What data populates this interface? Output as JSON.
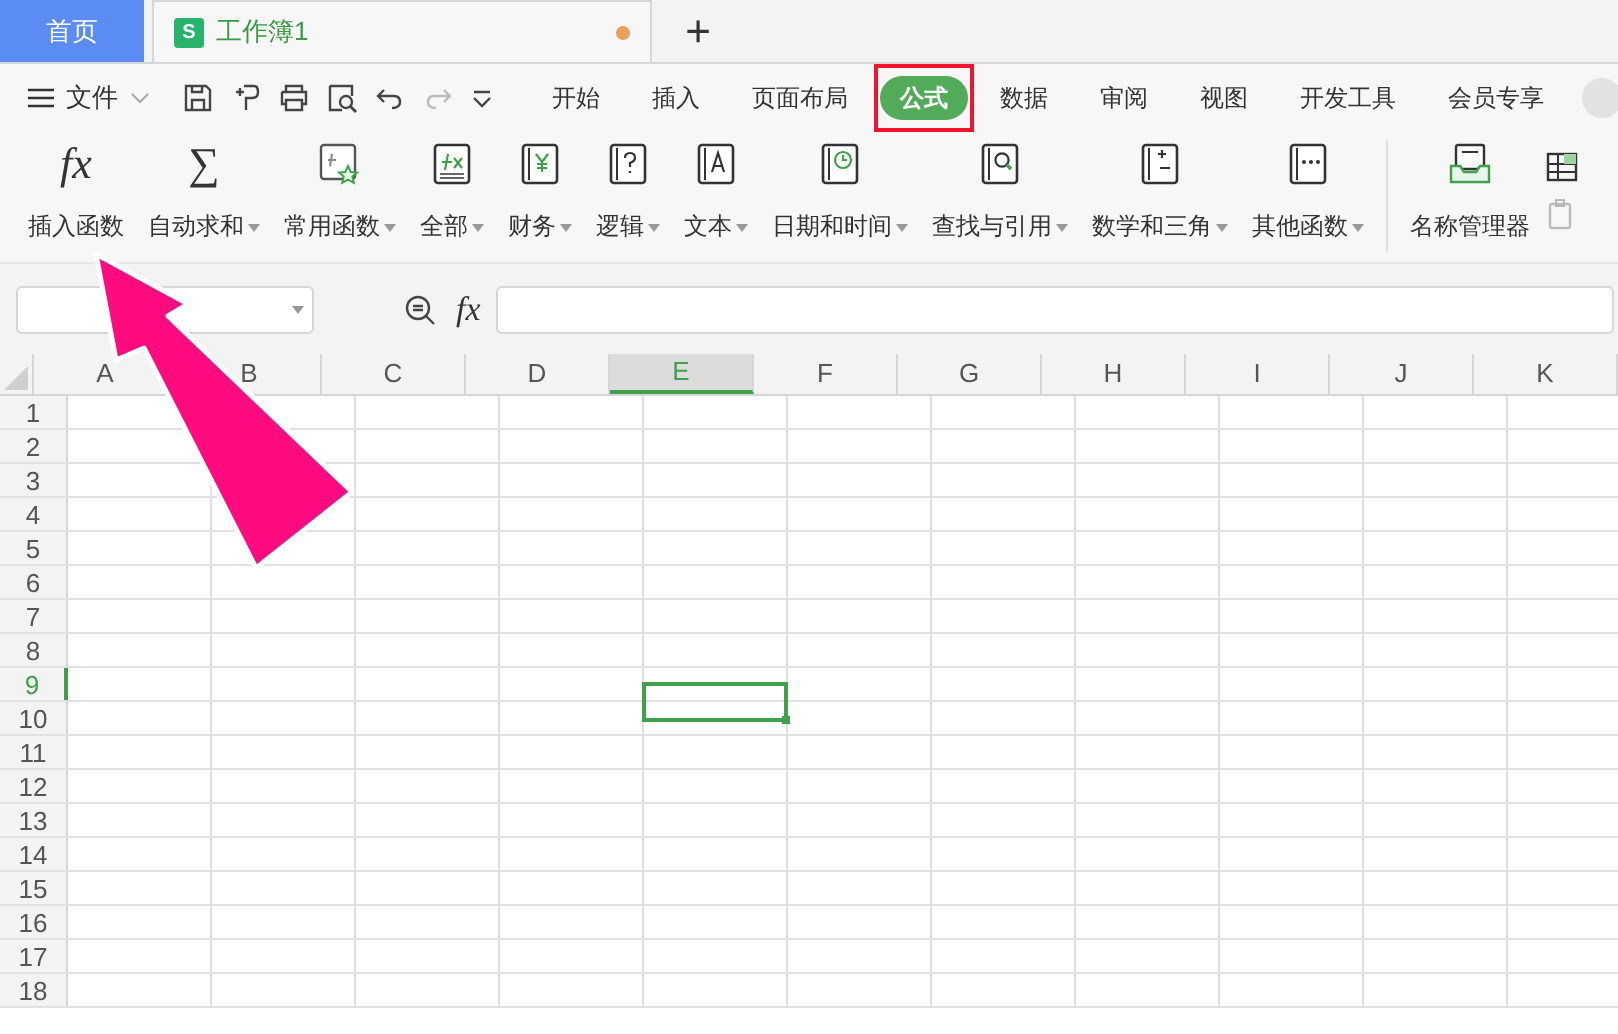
{
  "window_tabs": [
    {
      "kind": "home",
      "label": "首页",
      "selected": false
    },
    {
      "kind": "document",
      "label": "工作簿1",
      "icon_letter": "S",
      "unsaved": true,
      "selected": true
    }
  ],
  "new_tab": "+",
  "file_menu": "文件",
  "ribbon_tabs": [
    {
      "label": "开始",
      "selected": false,
      "highlighted": false
    },
    {
      "label": "插入",
      "selected": false,
      "highlighted": false
    },
    {
      "label": "页面布局",
      "selected": false,
      "highlighted": false
    },
    {
      "label": "公式",
      "selected": true,
      "highlighted": true
    },
    {
      "label": "数据",
      "selected": false,
      "highlighted": false
    },
    {
      "label": "审阅",
      "selected": false,
      "highlighted": false
    },
    {
      "label": "视图",
      "selected": false,
      "highlighted": false
    },
    {
      "label": "开发工具",
      "selected": false,
      "highlighted": false
    },
    {
      "label": "会员专享",
      "selected": false,
      "highlighted": false
    }
  ],
  "ribbon_buttons": [
    {
      "kind": "fx",
      "icon_text": "fx",
      "label": "插入函数",
      "dropdown": false
    },
    {
      "kind": "sigma",
      "icon_text": "∑",
      "label": "自动求和",
      "dropdown": true
    },
    {
      "kind": "star",
      "label": "常用函数",
      "dropdown": true
    },
    {
      "kind": "fxbox",
      "label": "全部",
      "dropdown": true
    },
    {
      "kind": "yen",
      "label": "财务",
      "dropdown": true
    },
    {
      "kind": "question",
      "label": "逻辑",
      "dropdown": true
    },
    {
      "kind": "letter",
      "label": "文本",
      "dropdown": true
    },
    {
      "kind": "clock",
      "label": "日期和时间",
      "dropdown": true
    },
    {
      "kind": "search",
      "label": "查找与引用",
      "dropdown": true
    },
    {
      "kind": "math",
      "label": "数学和三角",
      "dropdown": true
    },
    {
      "kind": "dots",
      "label": "其他函数",
      "dropdown": true
    },
    {
      "kind": "tray",
      "label": "名称管理器",
      "dropdown": false
    }
  ],
  "formula_bar": {
    "fx_label": "fx"
  },
  "grid": {
    "columns": [
      {
        "label": "A",
        "selected": false
      },
      {
        "label": "B",
        "selected": false
      },
      {
        "label": "C",
        "selected": false
      },
      {
        "label": "D",
        "selected": false
      },
      {
        "label": "E",
        "selected": true
      },
      {
        "label": "F",
        "selected": false
      },
      {
        "label": "G",
        "selected": false
      },
      {
        "label": "H",
        "selected": false
      },
      {
        "label": "I",
        "selected": false
      },
      {
        "label": "J",
        "selected": false
      },
      {
        "label": "K",
        "selected": false
      }
    ],
    "rows": [
      {
        "label": "1",
        "selected": false
      },
      {
        "label": "2",
        "selected": false
      },
      {
        "label": "3",
        "selected": false
      },
      {
        "label": "4",
        "selected": false
      },
      {
        "label": "5",
        "selected": false
      },
      {
        "label": "6",
        "selected": false
      },
      {
        "label": "7",
        "selected": false
      },
      {
        "label": "8",
        "selected": false
      },
      {
        "label": "9",
        "selected": true
      },
      {
        "label": "10",
        "selected": false
      },
      {
        "label": "11",
        "selected": false
      },
      {
        "label": "12",
        "selected": false
      },
      {
        "label": "13",
        "selected": false
      },
      {
        "label": "14",
        "selected": false
      },
      {
        "label": "15",
        "selected": false
      },
      {
        "label": "16",
        "selected": false
      },
      {
        "label": "17",
        "selected": false
      },
      {
        "label": "18",
        "selected": false
      }
    ]
  }
}
